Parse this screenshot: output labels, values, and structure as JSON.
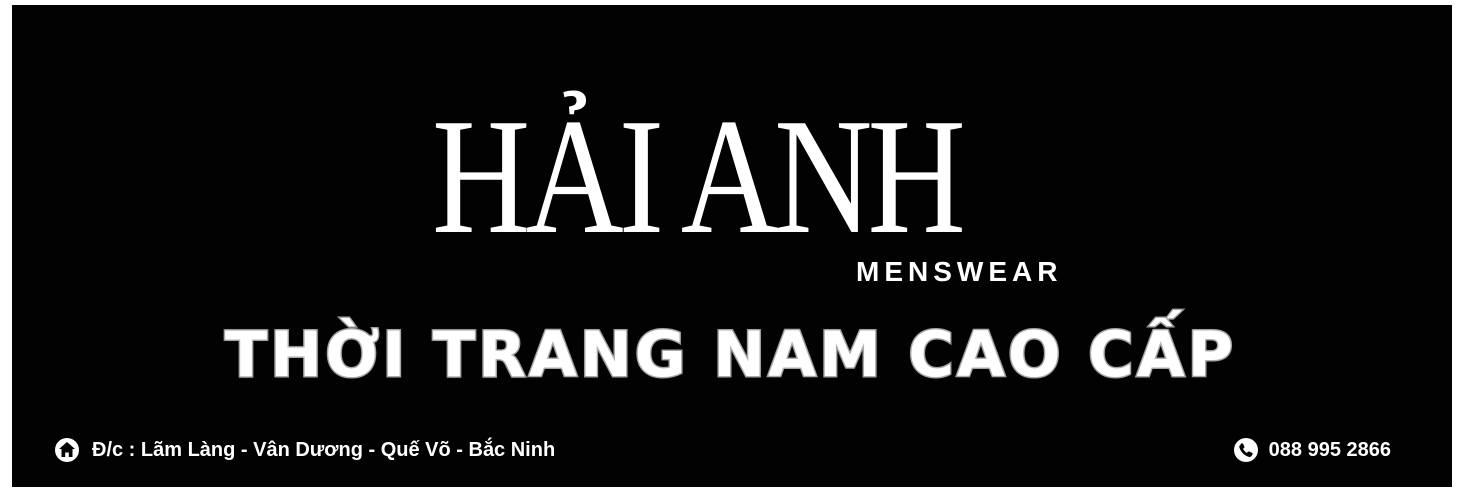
{
  "brand": {
    "name": "HẢI ANH",
    "subtitle": "MENSWEAR"
  },
  "tagline": "THỜI TRANG NAM CAO CẤP",
  "contact": {
    "address": "Đ/c : Lãm Làng - Vân Dương - Quế Võ - Bắc Ninh",
    "phone": "088 995 2866",
    "address_icon": "home-icon",
    "phone_icon": "phone-icon"
  },
  "colors": {
    "background": "#020202",
    "text": "#ffffff",
    "tagline_outline": "#9a9a9a"
  }
}
